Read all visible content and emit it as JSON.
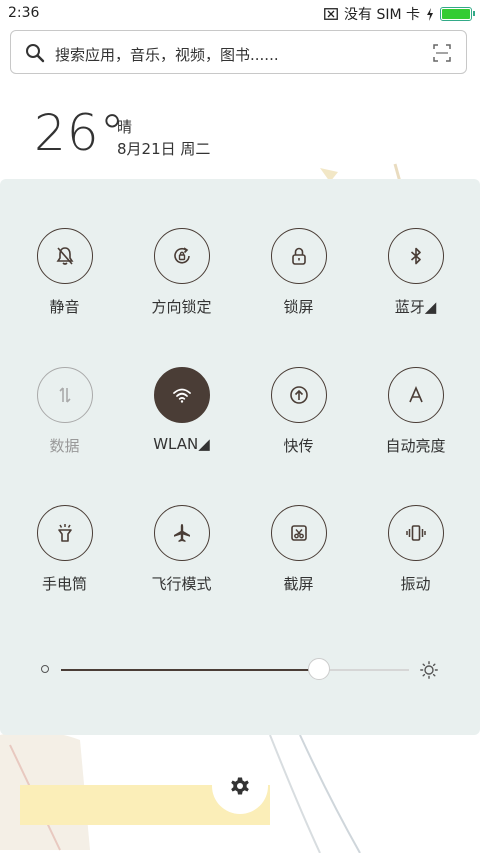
{
  "status_bar": {
    "time": "2:36",
    "sim_status": "没有 SIM 卡",
    "battery_percent": 100
  },
  "search": {
    "placeholder": "搜索应用，音乐，视频，图书......"
  },
  "weather": {
    "temperature": "26°",
    "condition": "晴",
    "date": "8月21日 周二"
  },
  "toggles": [
    {
      "label": "静音",
      "icon": "silent-icon",
      "active": false,
      "disabled": false
    },
    {
      "label": "方向锁定",
      "icon": "rotation-lock-icon",
      "active": false,
      "disabled": false
    },
    {
      "label": "锁屏",
      "icon": "lock-icon",
      "active": false,
      "disabled": false
    },
    {
      "label": "蓝牙◢",
      "icon": "bluetooth-icon",
      "active": false,
      "disabled": false
    },
    {
      "label": "数据",
      "icon": "data-icon",
      "active": false,
      "disabled": true
    },
    {
      "label": "WLAN◢",
      "icon": "wifi-icon",
      "active": true,
      "disabled": false
    },
    {
      "label": "快传",
      "icon": "quick-transfer-icon",
      "active": false,
      "disabled": false
    },
    {
      "label": "自动亮度",
      "icon": "auto-brightness-icon",
      "active": false,
      "disabled": false
    },
    {
      "label": "手电筒",
      "icon": "flashlight-icon",
      "active": false,
      "disabled": false
    },
    {
      "label": "飞行模式",
      "icon": "airplane-icon",
      "active": false,
      "disabled": false
    },
    {
      "label": "截屏",
      "icon": "screenshot-icon",
      "active": false,
      "disabled": false
    },
    {
      "label": "振动",
      "icon": "vibrate-icon",
      "active": false,
      "disabled": false
    }
  ],
  "brightness": {
    "level": 0.74
  },
  "colors": {
    "accent": "#4a3d36",
    "panel_bg": "#e9f0ef"
  }
}
